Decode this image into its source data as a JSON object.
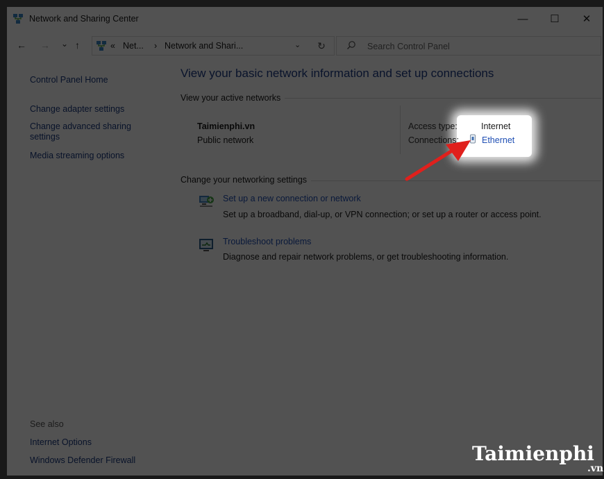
{
  "window": {
    "title": "Network and Sharing Center",
    "controls": {
      "minimize": "—",
      "maximize": "☐",
      "close": "✕"
    }
  },
  "addressbar": {
    "back": "←",
    "forward": "→",
    "recent": "⌄",
    "up": "↑",
    "overflow": "«",
    "crumb1": "Net...",
    "sep": "›",
    "crumb2": "Network and Shari...",
    "dropdown": "⌄",
    "refresh": "↻"
  },
  "search": {
    "placeholder": "Search Control Panel",
    "icon": "⌕"
  },
  "sidebar": {
    "home": "Control Panel Home",
    "items": [
      {
        "label": "Change adapter settings"
      },
      {
        "label": "Change advanced sharing settings"
      },
      {
        "label": "Media streaming options"
      }
    ],
    "see_also_label": "See also",
    "see_also": [
      {
        "label": "Internet Options"
      },
      {
        "label": "Windows Defender Firewall"
      }
    ]
  },
  "main": {
    "heading": "View your basic network information and set up connections",
    "active_networks_label": "View your active networks",
    "network": {
      "name": "Taimienphi.vn",
      "type": "Public network",
      "access_type_label": "Access type:",
      "access_type_value": "Internet",
      "connections_label": "Connections:",
      "connections_value": "Ethernet"
    },
    "change_settings_label": "Change your networking settings",
    "tasks": [
      {
        "title": "Set up a new connection or network",
        "description": "Set up a broadband, dial-up, or VPN connection; or set up a router or access point."
      },
      {
        "title": "Troubleshoot problems",
        "description": "Diagnose and repair network problems, or get troubleshooting information."
      }
    ]
  },
  "watermark": {
    "brand": "Taimienphi",
    "suffix": ".vn"
  },
  "colors": {
    "link": "#1f4fb4",
    "heading": "#1e3c87",
    "arrow": "#e0201c",
    "overlay": "#000000"
  }
}
